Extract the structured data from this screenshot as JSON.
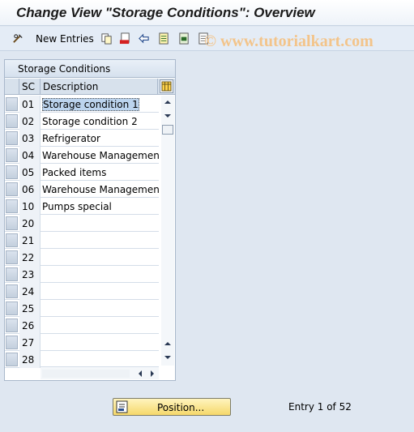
{
  "window": {
    "title": "Change View \"Storage Conditions\": Overview"
  },
  "toolbar": {
    "new_entries_label": "New Entries",
    "icons": [
      "pen-glasses-icon",
      "copy-icon",
      "delete-icon",
      "undo-icon",
      "select-all-icon",
      "select-block-icon",
      "deselect-all-icon"
    ]
  },
  "watermark": "© www.tutorialkart.com",
  "table": {
    "title": "Storage Conditions",
    "columns": {
      "sc": "SC",
      "description": "Description"
    },
    "rows": [
      {
        "sc": "01",
        "desc": "Storage condition 1"
      },
      {
        "sc": "02",
        "desc": "Storage condition 2"
      },
      {
        "sc": "03",
        "desc": "Refrigerator"
      },
      {
        "sc": "04",
        "desc": "Warehouse Management"
      },
      {
        "sc": "05",
        "desc": "Packed items"
      },
      {
        "sc": "06",
        "desc": "Warehouse Management"
      },
      {
        "sc": "10",
        "desc": "Pumps special"
      },
      {
        "sc": "20",
        "desc": ""
      },
      {
        "sc": "21",
        "desc": ""
      },
      {
        "sc": "22",
        "desc": ""
      },
      {
        "sc": "23",
        "desc": ""
      },
      {
        "sc": "24",
        "desc": ""
      },
      {
        "sc": "25",
        "desc": ""
      },
      {
        "sc": "26",
        "desc": ""
      },
      {
        "sc": "27",
        "desc": ""
      },
      {
        "sc": "28",
        "desc": ""
      }
    ]
  },
  "footer": {
    "position_button": "Position...",
    "entry_info": "Entry 1 of 52"
  },
  "colors": {
    "button_yellow": "#f5d86a",
    "table_header": "#d7e1ec",
    "selection": "#bcd4ee"
  }
}
